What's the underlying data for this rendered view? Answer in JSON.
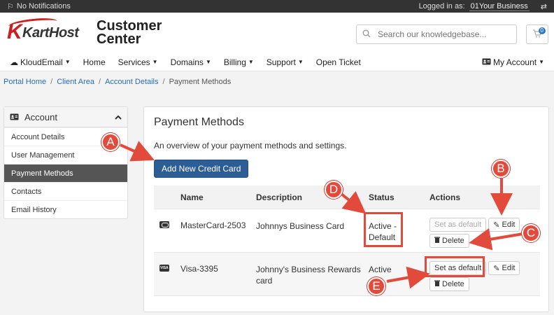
{
  "topbar": {
    "notifications": "No Notifications",
    "logged_in_label": "Logged in as:",
    "business": "01Your Business"
  },
  "header": {
    "logo_text": "KartHost",
    "tagline_line1": "Customer",
    "tagline_line2": "Center",
    "search_placeholder": "Search our knowledgebase...",
    "cart_count": "0"
  },
  "nav": {
    "items": [
      {
        "label": "KloudEmail",
        "caret": true
      },
      {
        "label": "Home",
        "caret": false
      },
      {
        "label": "Services",
        "caret": true
      },
      {
        "label": "Domains",
        "caret": true
      },
      {
        "label": "Billing",
        "caret": true
      },
      {
        "label": "Support",
        "caret": true
      },
      {
        "label": "Open Ticket",
        "caret": false
      }
    ],
    "account": "My Account"
  },
  "breadcrumb": [
    "Portal Home",
    "Client Area",
    "Account Details",
    "Payment Methods"
  ],
  "sidebar": {
    "title": "Account",
    "items": [
      "Account Details",
      "User Management",
      "Payment Methods",
      "Contacts",
      "Email History"
    ]
  },
  "main": {
    "title": "Payment Methods",
    "description": "An overview of your payment methods and settings.",
    "add_button": "Add New Credit Card",
    "columns": [
      "Name",
      "Description",
      "Status",
      "Actions"
    ],
    "rows": [
      {
        "name": "MasterCard-2503",
        "description": "Johnnys Business Card",
        "status_line1": "Active -",
        "status_line2": "Default",
        "set_default": "Set as default",
        "edit": "Edit",
        "delete": "Delete"
      },
      {
        "name": "Visa-3395",
        "description": "Johnny's Business Rewards card",
        "status_line1": "Active",
        "status_line2": "",
        "set_default": "Set as default",
        "edit": "Edit",
        "delete": "Delete"
      }
    ]
  },
  "annotations": {
    "a": "A",
    "b": "B",
    "c": "C",
    "d": "D",
    "e": "E",
    "color": "#e24a3b"
  }
}
